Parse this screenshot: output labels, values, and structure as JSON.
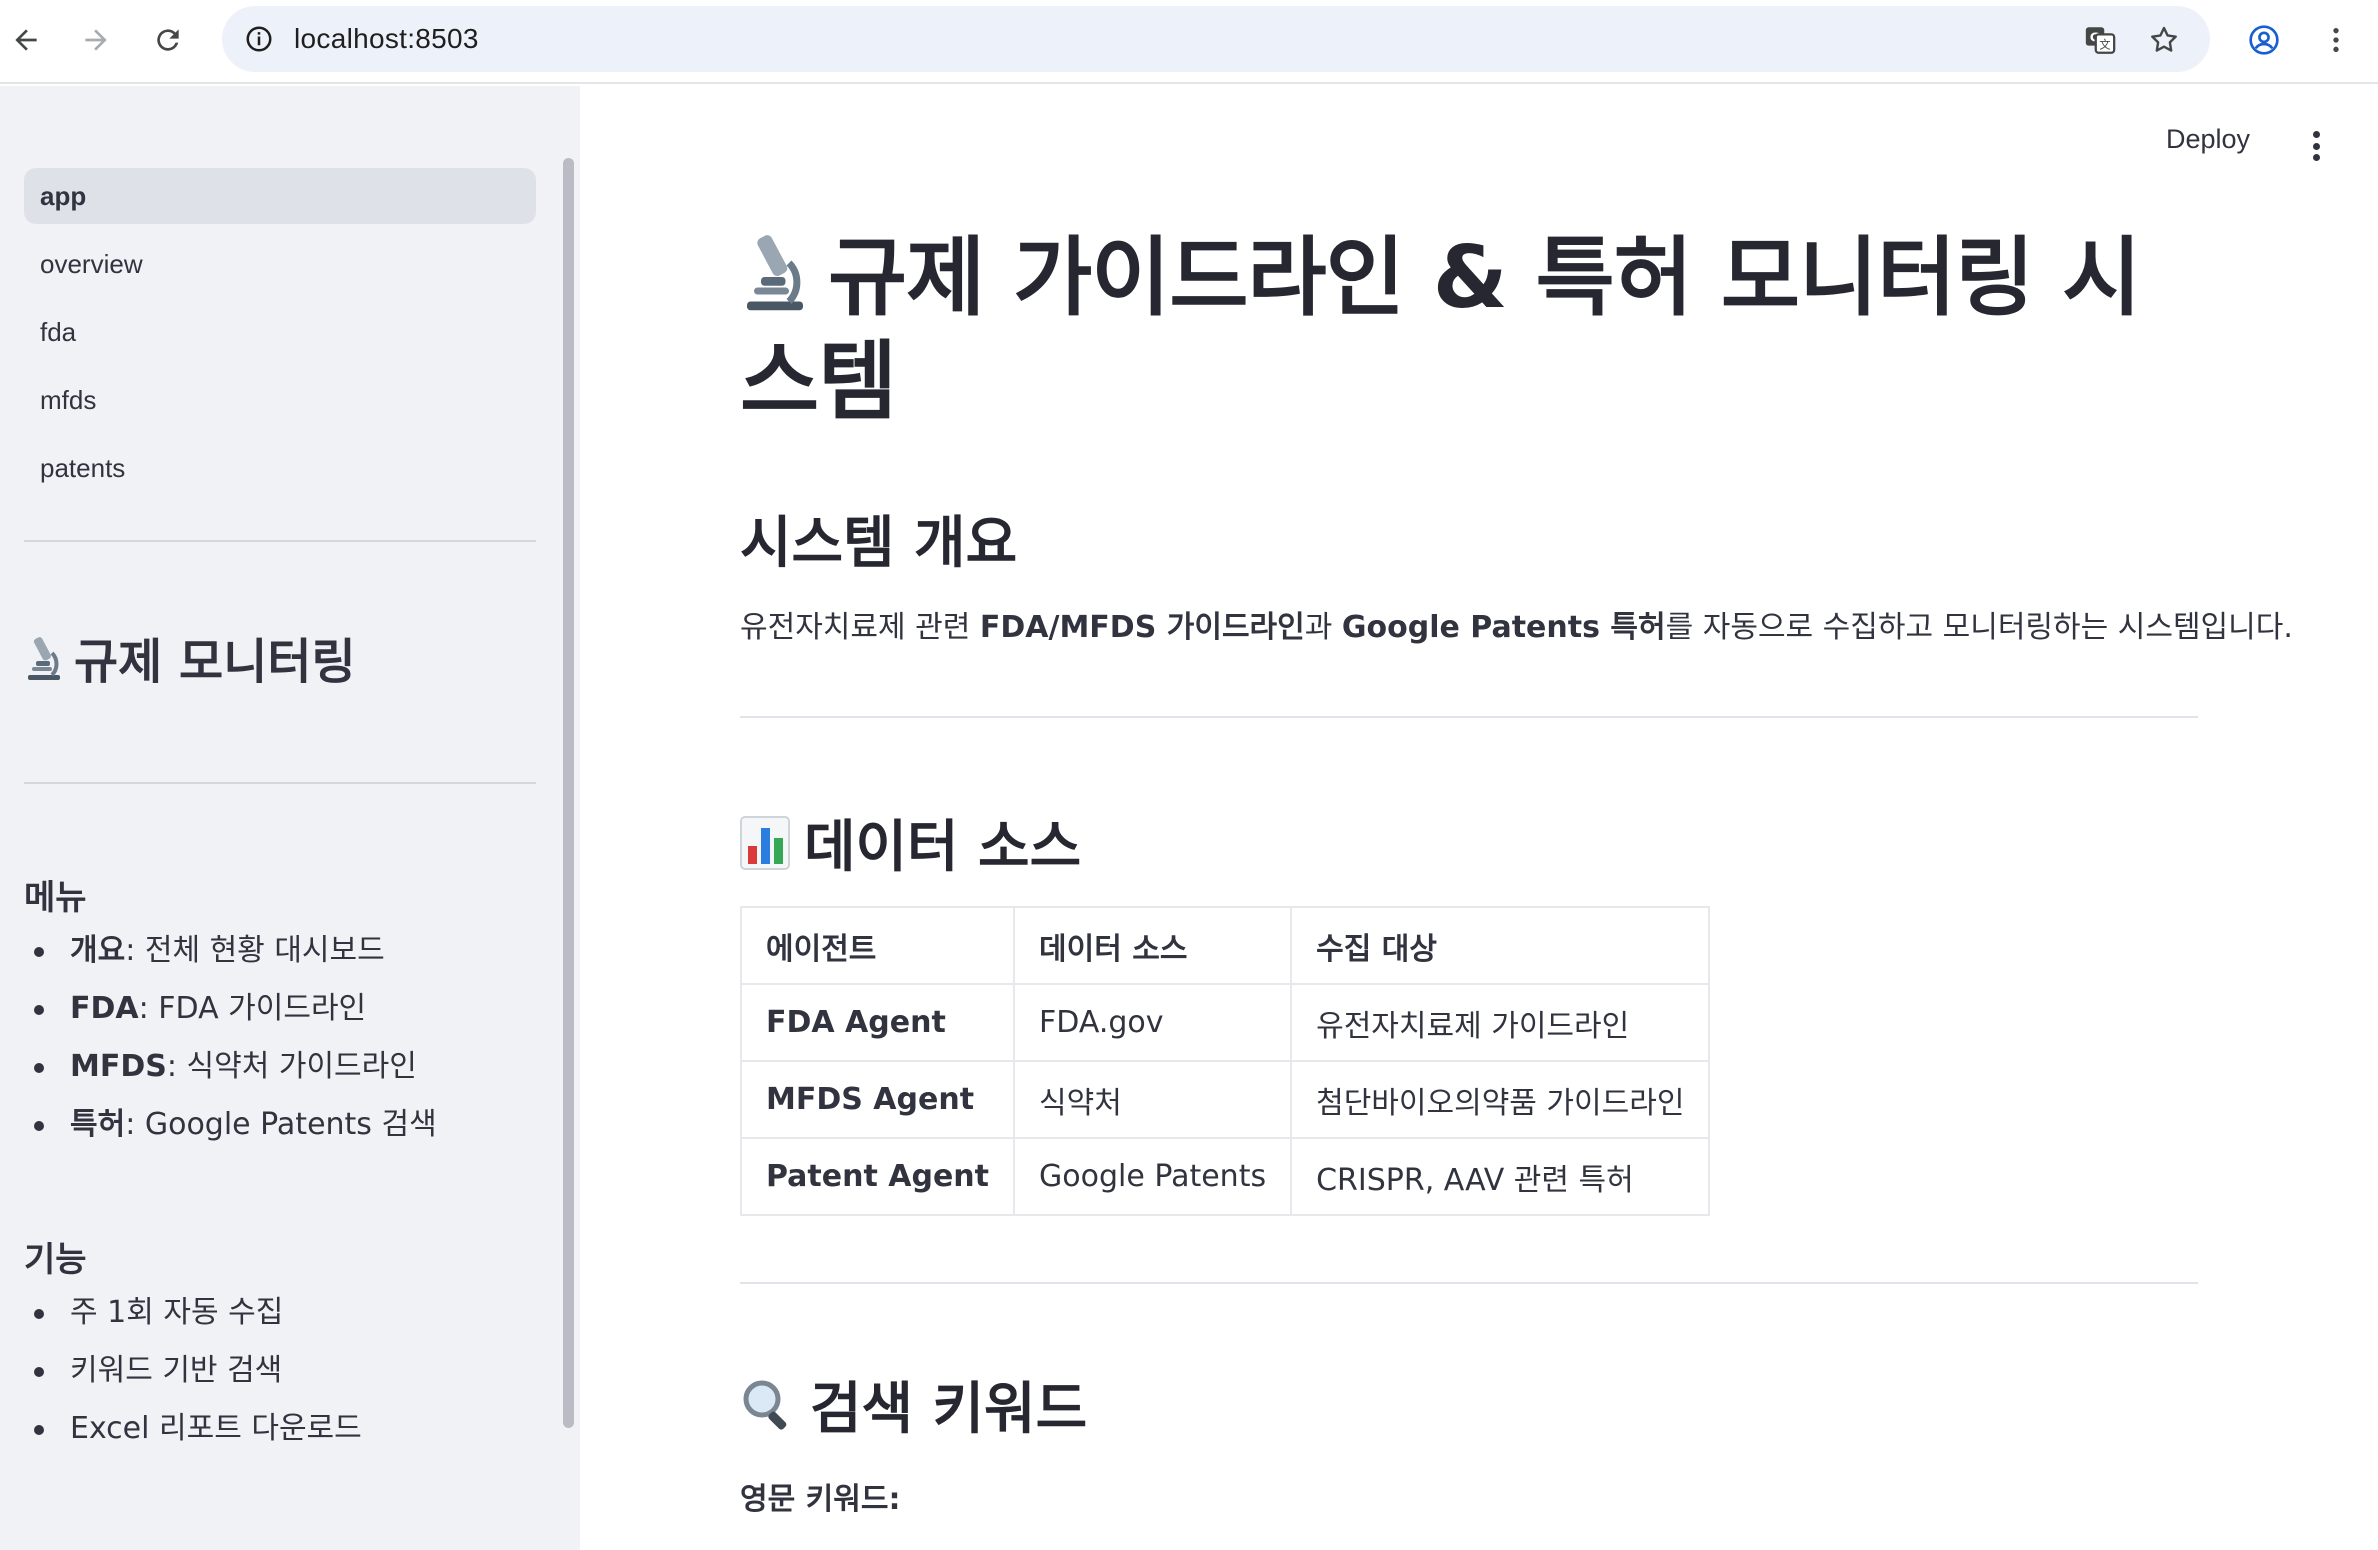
{
  "browser": {
    "url": "localhost:8503"
  },
  "toolbar": {
    "deploy_label": "Deploy"
  },
  "sidebar": {
    "nav": [
      {
        "label": "app",
        "active": true
      },
      {
        "label": "overview",
        "active": false
      },
      {
        "label": "fda",
        "active": false
      },
      {
        "label": "mfds",
        "active": false
      },
      {
        "label": "patents",
        "active": false
      }
    ],
    "title": "규제 모니터링",
    "menu_heading": "메뉴",
    "menu": [
      {
        "bold": "개요",
        "text": ": 전체 현황 대시보드"
      },
      {
        "bold": "FDA",
        "text": ": FDA 가이드라인"
      },
      {
        "bold": "MFDS",
        "text": ": 식약처 가이드라인"
      },
      {
        "bold": "특허",
        "text": ": Google Patents 검색"
      }
    ],
    "features_heading": "기능",
    "features": [
      "주 1회 자동 수집",
      "키워드 기반 검색",
      "Excel 리포트 다운로드"
    ]
  },
  "main": {
    "title": "규제 가이드라인 & 특허 모니터링 시스템",
    "overview_heading": "시스템 개요",
    "overview_text": {
      "p1": "유전자치료제 관련 ",
      "b1": "FDA/MFDS 가이드라인",
      "p2": "과 ",
      "b2": "Google Patents 특허",
      "p3": "를 자동으로 수집하고 모니터링하는 시스템입니다."
    },
    "sources_heading": "데이터 소스",
    "table": {
      "headers": [
        "에이전트",
        "데이터 소스",
        "수집 대상"
      ],
      "rows": [
        [
          "FDA Agent",
          "FDA.gov",
          "유전자치료제 가이드라인"
        ],
        [
          "MFDS Agent",
          "식약처",
          "첨단바이오의약품 가이드라인"
        ],
        [
          "Patent Agent",
          "Google Patents",
          "CRISPR, AAV 관련 특허"
        ]
      ]
    },
    "keywords_heading": "검색 키워드",
    "english_keywords_label": "영문 키워드:"
  },
  "icons": {
    "microscope": "microscope-icon",
    "chart": "bar-chart-icon",
    "magnifier": "magnifier-icon"
  },
  "colors": {
    "sidebar_bg": "#f0f2f6",
    "text": "#31333f",
    "omnibox_bg": "#edf1f9"
  }
}
